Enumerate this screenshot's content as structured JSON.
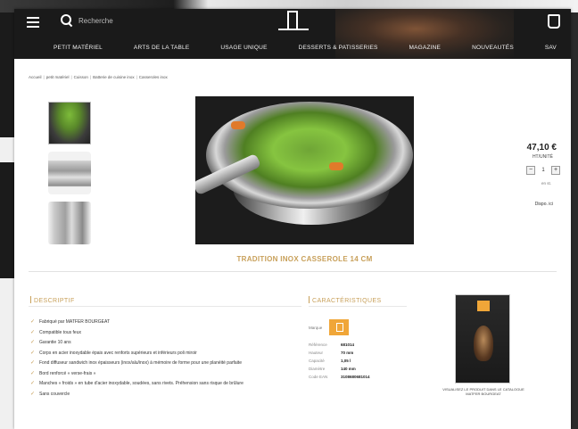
{
  "header": {
    "search_placeholder": "Recherche",
    "nav": [
      "PETIT MATÉRIEL",
      "ARTS DE LA TABLE",
      "USAGE UNIQUE",
      "DESSERTS & PATISSERIES",
      "MAGAZINE",
      "NOUVEAUTÉS",
      "SAV"
    ]
  },
  "breadcrumb": [
    "Accueil",
    "petit matériel",
    "Cuisson",
    "Batterie de cuisine inox",
    "Casseroles inox"
  ],
  "product": {
    "title": "TRADITION INOX CASSEROLE 14 CM",
    "price": "47,10 €",
    "unit": "HT/UNITÉ",
    "quantity": "1",
    "stock_note": "en st.",
    "link": "Dispo. ici"
  },
  "description": {
    "title": "DESCRIPTIF",
    "items": [
      "Fabriqué par MATFER BOURGEAT",
      "Compatible tous feux",
      "Garantie 10 ans",
      "Corps en acier inoxydable épais avec renforts supérieurs et inférieurs poli miroir",
      "Fond diffuseur sandwich inox épaisseurs (inox/alu/inox) à mémoire de forme pour une planéité parfaite",
      "Bord renforcé « verse-frais »",
      "Manches « froids » en tube d'acier inoxydable, soudées, sans rivets. Préhension sans risque de brûlure",
      "Sans couvercle"
    ]
  },
  "characteristics": {
    "title": "CARACTÉRISTIQUES",
    "brand_label": "Marque",
    "specs": [
      {
        "k": "Référence",
        "v": "681014"
      },
      {
        "k": "Hauteur",
        "v": "70 mm"
      },
      {
        "k": "Capacité",
        "v": "1,05 l"
      },
      {
        "k": "Diamètre",
        "v": "140 mm"
      },
      {
        "k": "Code EAN",
        "v": "3108680681014"
      }
    ]
  },
  "book": {
    "caption": "VISUALISEZ LE PRODUIT DANS LE CATALOGUE MATFER BOURGEAT"
  }
}
